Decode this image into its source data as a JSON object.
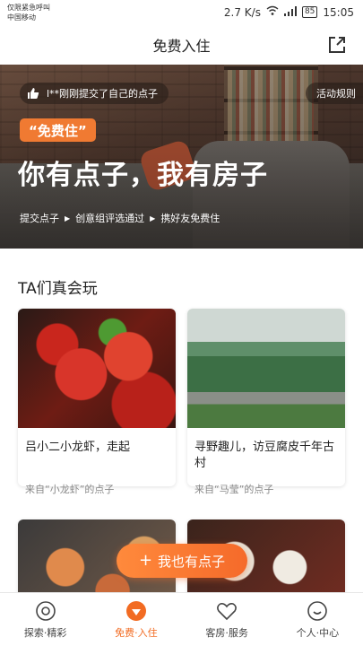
{
  "status": {
    "carrier_line1": "仅限紧急呼叫",
    "carrier_line2": "中国移动",
    "speed": "2.7 K/s",
    "battery": "85",
    "time": "15:05"
  },
  "header": {
    "title": "免费入住",
    "share_icon": "share-icon"
  },
  "banner": {
    "notice": "l**刚刚提交了自己的点子",
    "rules": "活动规则",
    "tag": "“免费住”",
    "headline": "你有点子，我有房子",
    "steps": [
      "提交点子",
      "创意组评选通过",
      "携好友免费住"
    ]
  },
  "section": {
    "title": "TA们真会玩"
  },
  "cards": [
    {
      "title": "吕小二小龙虾，走起",
      "source": "来自“小龙虾”的点子"
    },
    {
      "title": "寻野趣儿，访豆腐皮千年古村",
      "source": "来自“马莹”的点子"
    }
  ],
  "fab": {
    "label": "我也有点子"
  },
  "tabs": [
    {
      "label": "探索·精彩",
      "icon": "explore-icon"
    },
    {
      "label": "免费·入住",
      "icon": "gem-icon"
    },
    {
      "label": "客房·服务",
      "icon": "heart-icon"
    },
    {
      "label": "个人·中心",
      "icon": "profile-icon"
    }
  ],
  "colors": {
    "accent": "#f26b22"
  }
}
